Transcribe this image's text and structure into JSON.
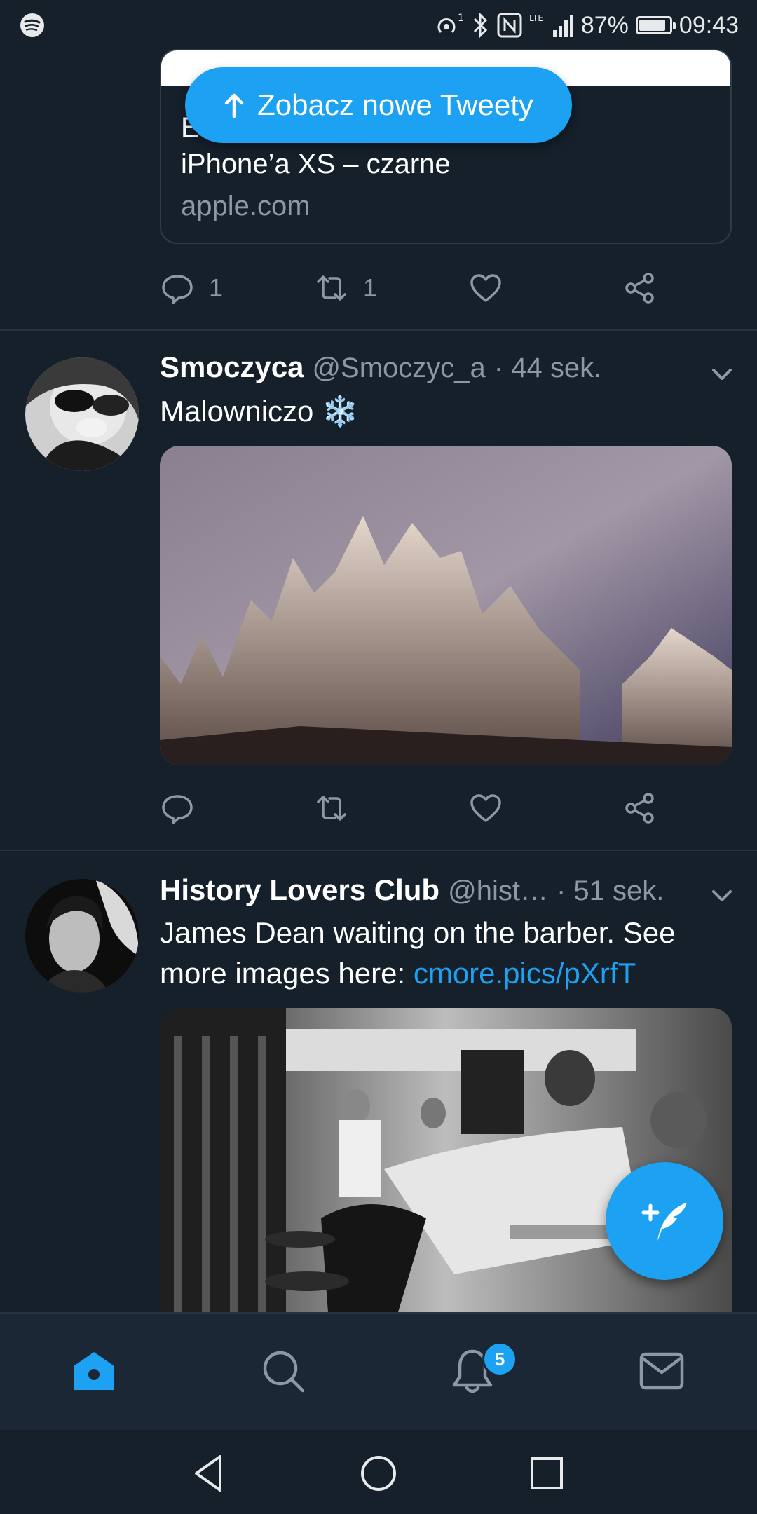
{
  "status_bar": {
    "battery_percent_text": "87%",
    "battery_level": 0.87,
    "time": "09:43",
    "network": "LTE",
    "icons": [
      "spotify-icon",
      "hotspot-icon",
      "bluetooth-icon",
      "nfc-icon",
      "signal-icon",
      "battery-icon"
    ]
  },
  "new_tweets_pill": {
    "label": "Zobacz nowe Tweety",
    "icon": "arrow-up-icon"
  },
  "link_card": {
    "title_line1": "E",
    "title_line2": "iPhone’a XS – czarne",
    "domain": "apple.com"
  },
  "tweet0_actions": {
    "reply_count": "1",
    "retweet_count": "1",
    "like_count": "",
    "share_count": ""
  },
  "tweets": [
    {
      "name": "Smoczyca",
      "handle": "@Smoczyc_a",
      "time": "· 44 sek.",
      "text": "Malowniczo ❄️",
      "media": "snowy-pine-trees-photo",
      "reply_count": "",
      "retweet_count": ""
    },
    {
      "name": "History Lovers Club",
      "handle": "@hist…",
      "time": "· 51 sek.",
      "text": "James Dean waiting on the barber. See more images here: ",
      "link": "cmore.pics/pXrfT",
      "media": "barbershop-photo"
    }
  ],
  "bottom_nav": {
    "items": [
      "home-icon",
      "search-icon",
      "notifications-icon",
      "messages-icon"
    ],
    "notification_badge": "5"
  },
  "colors": {
    "background": "#15202b",
    "accent": "#1da1f2",
    "muted": "#8b98a5",
    "nav": "#1b2734"
  }
}
